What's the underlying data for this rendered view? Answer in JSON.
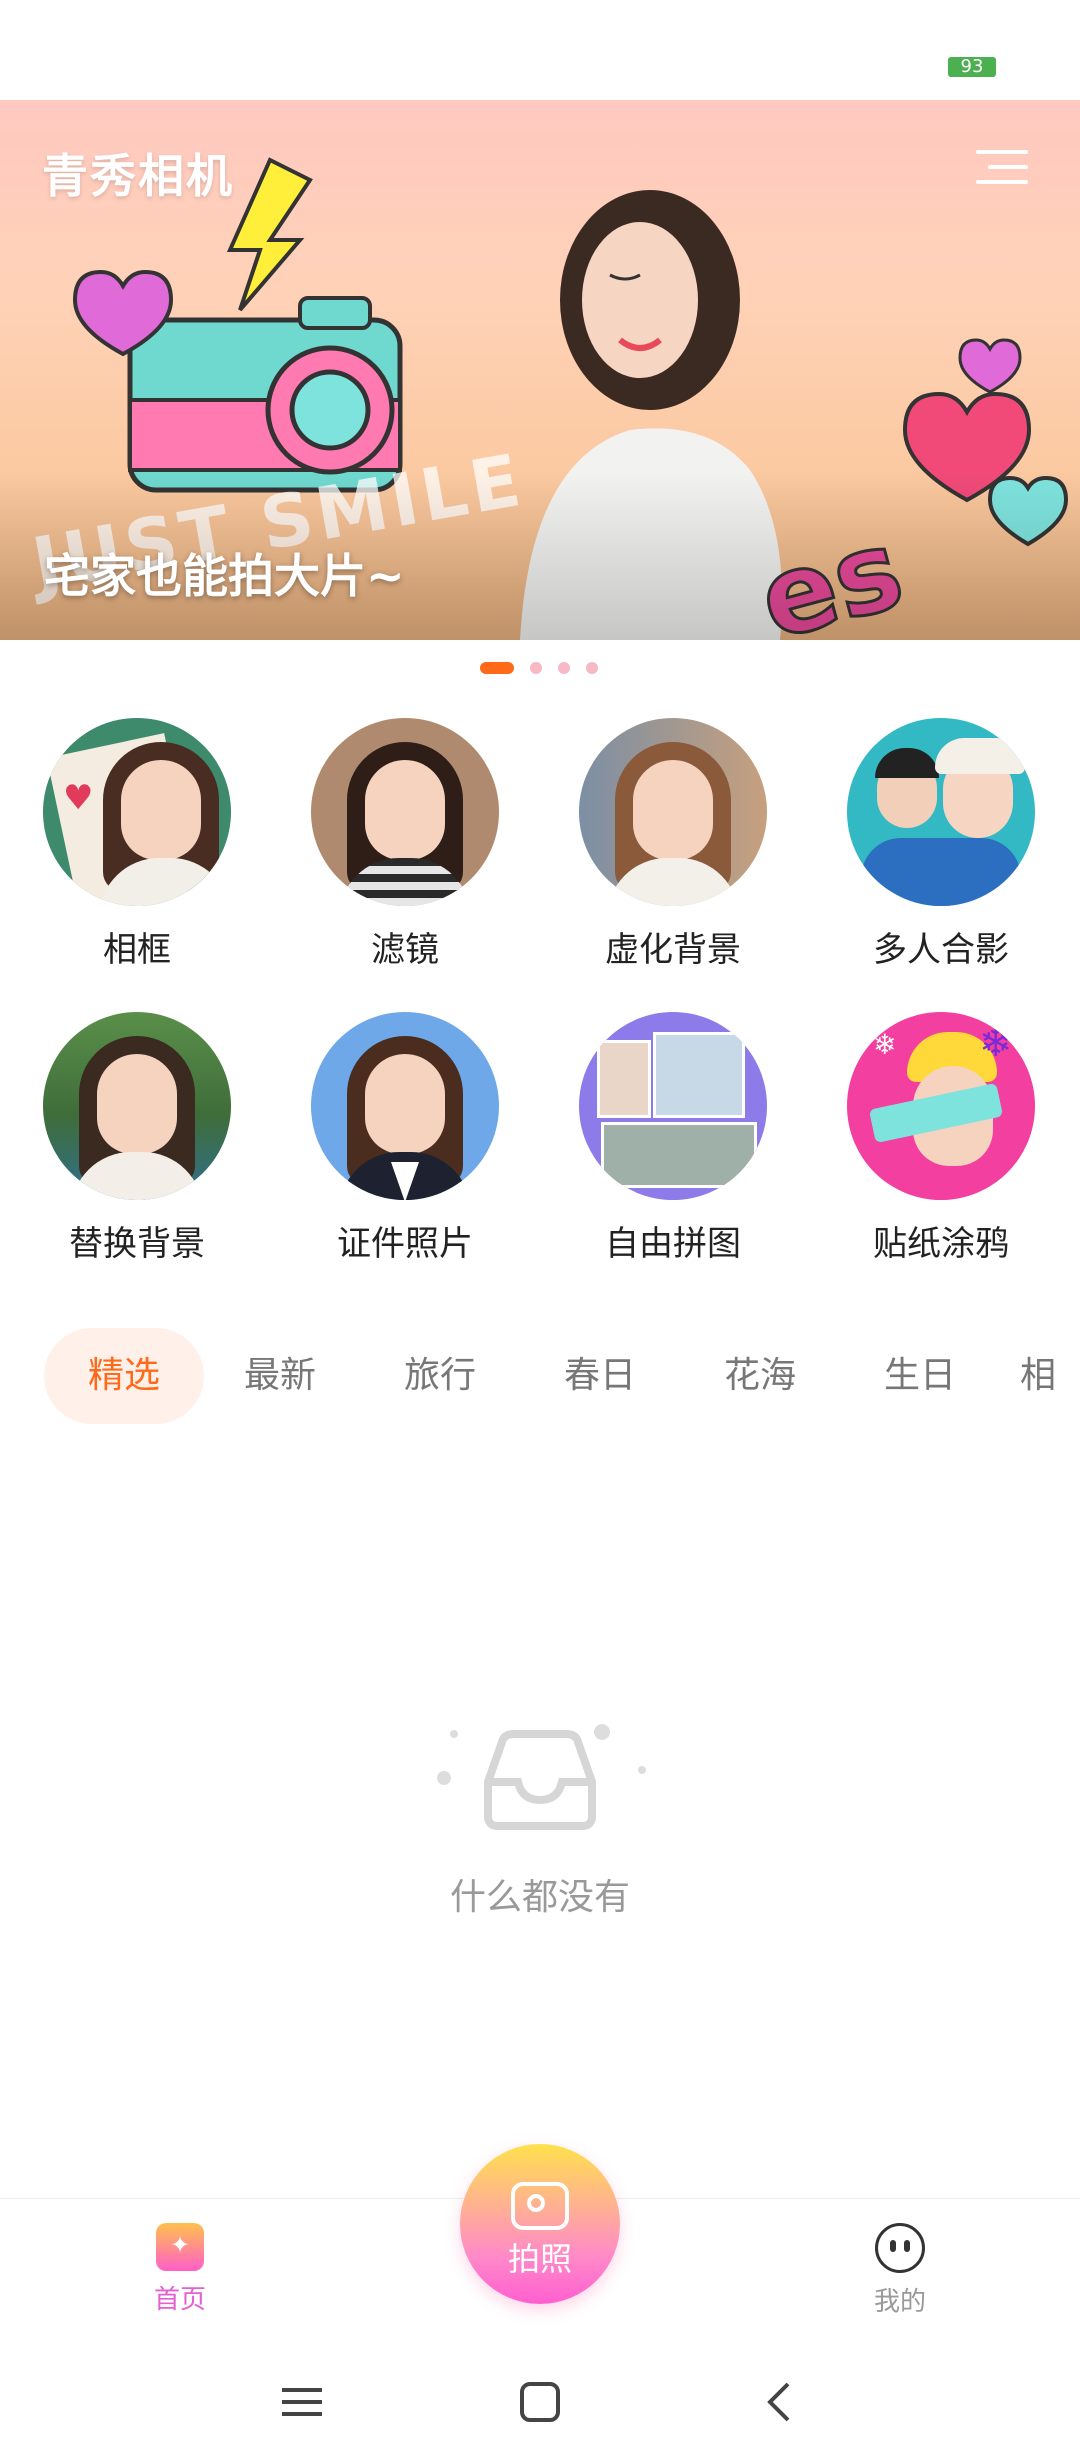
{
  "status": {
    "battery": "93"
  },
  "banner": {
    "app_title": "青秀相机",
    "caption": "宅家也能拍大片~",
    "art_text": "JUST SMILE",
    "slides": 4,
    "active_slide": 1
  },
  "features": [
    {
      "label": "相框",
      "icon": "frame-icon"
    },
    {
      "label": "滤镜",
      "icon": "filter-icon"
    },
    {
      "label": "虚化背景",
      "icon": "blur-background-icon"
    },
    {
      "label": "多人合影",
      "icon": "group-photo-icon"
    },
    {
      "label": "替换背景",
      "icon": "replace-background-icon"
    },
    {
      "label": "证件照片",
      "icon": "id-photo-icon"
    },
    {
      "label": "自由拼图",
      "icon": "collage-icon"
    },
    {
      "label": "贴纸涂鸦",
      "icon": "sticker-icon"
    }
  ],
  "tabs": [
    "精选",
    "最新",
    "旅行",
    "春日",
    "花海",
    "生日",
    "相"
  ],
  "active_tab": "精选",
  "empty": {
    "text": "什么都没有"
  },
  "bottom_nav": {
    "home_label": "首页",
    "shoot_label": "拍照",
    "me_label": "我的"
  },
  "colors": {
    "accent": "#ff6a1a",
    "home_active": "#e45fd2",
    "inactive": "#999999"
  }
}
